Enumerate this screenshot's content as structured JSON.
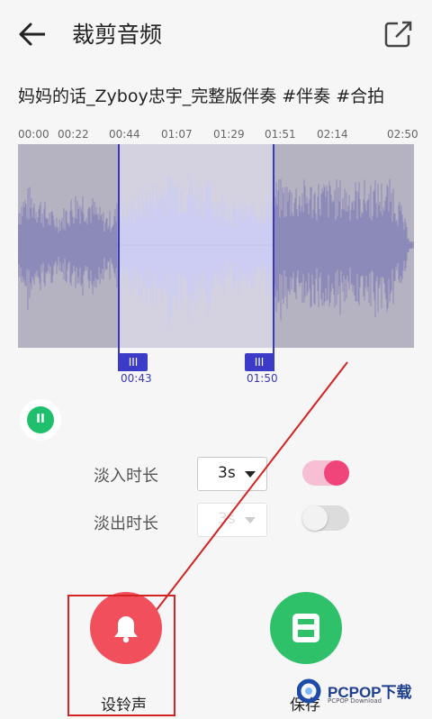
{
  "header": {
    "title": "裁剪音频",
    "back_icon": "arrow-left-icon",
    "export_icon": "export-icon"
  },
  "song_title": "妈妈的话_Zyboy忠宇_完整版伴奏 #伴奏 #合拍",
  "timeline": {
    "ticks": [
      "00:00",
      "00:22",
      "00:44",
      "01:07",
      "01:29",
      "01:51",
      "02:14",
      "02:50"
    ]
  },
  "selection": {
    "start_label": "00:43",
    "end_label": "01:50",
    "handle_glyph": "III"
  },
  "player": {
    "pause_glyph": "II",
    "pause_icon": "pause-icon"
  },
  "options": {
    "fade_in": {
      "label": "淡入时长",
      "value": "3s",
      "enabled": true
    },
    "fade_out": {
      "label": "淡出时长",
      "value": "3s",
      "enabled": false
    }
  },
  "actions": {
    "ringtone": {
      "label": "设铃声",
      "icon": "bell-icon",
      "color": "#f24f5c"
    },
    "save": {
      "label": "保存",
      "icon": "save-icon",
      "color": "#2fc06a"
    }
  },
  "colors": {
    "accent": "#3b3bc7",
    "toggle_on": "#f0457a",
    "annotation": "#d42323"
  },
  "watermark": {
    "brand": "PCPOP下载",
    "sub": "PCPOP Download"
  }
}
